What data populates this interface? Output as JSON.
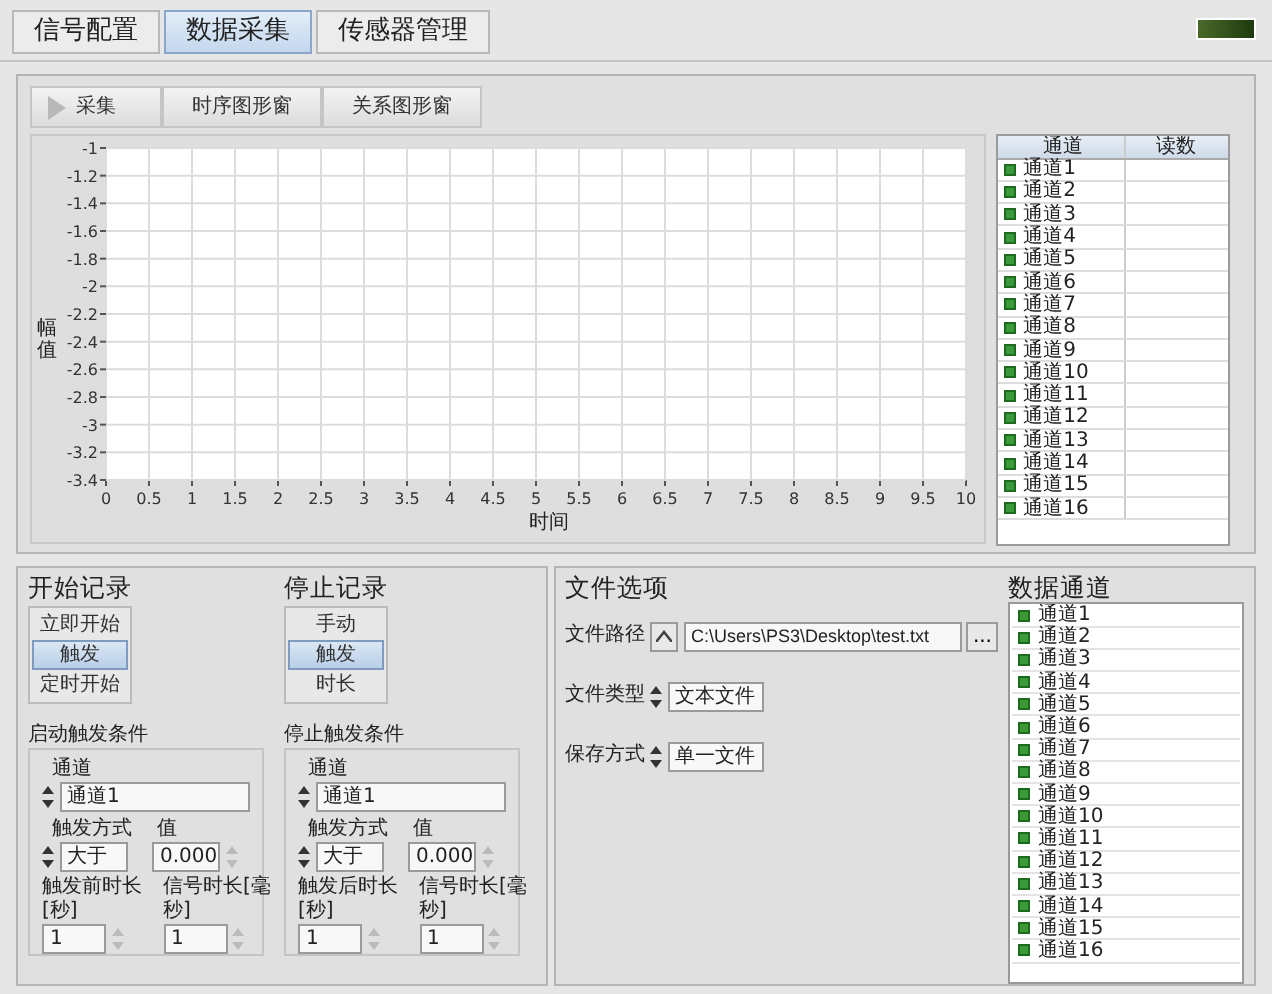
{
  "tabs": [
    {
      "label": "信号配置",
      "selected": false
    },
    {
      "label": "数据采集",
      "selected": true
    },
    {
      "label": "传感器管理",
      "selected": false
    }
  ],
  "status_led": {
    "on": false
  },
  "toolbar": [
    {
      "label": "采集",
      "kind": "run"
    },
    {
      "label": "时序图形窗",
      "kind": "plain"
    },
    {
      "label": "关系图形窗",
      "kind": "plain"
    }
  ],
  "graph": {
    "chart_data": {
      "type": "line",
      "grid": true,
      "xlabel": "时间",
      "ylabel": "幅值",
      "xlim": [
        0,
        10
      ],
      "ylim": [
        -3.4,
        -1
      ],
      "xticks": [
        0,
        0.5,
        1,
        1.5,
        2,
        2.5,
        3,
        3.5,
        4,
        4.5,
        5,
        5.5,
        6,
        6.5,
        7,
        7.5,
        8,
        8.5,
        9,
        9.5,
        10
      ],
      "yticks": [
        -1,
        -1.2,
        -1.4,
        -1.6,
        -1.8,
        -2,
        -2.2,
        -2.4,
        -2.6,
        -2.8,
        -3,
        -3.2,
        -3.4
      ]
    }
  },
  "reading_table": {
    "columns": [
      "通道",
      "读数"
    ],
    "rows": [
      {
        "channel": "通道1"
      },
      {
        "channel": "通道2"
      },
      {
        "channel": "通道3"
      },
      {
        "channel": "通道4"
      },
      {
        "channel": "通道5"
      },
      {
        "channel": "通道6"
      },
      {
        "channel": "通道7"
      },
      {
        "channel": "通道8"
      },
      {
        "channel": "通道9"
      },
      {
        "channel": "通道10"
      },
      {
        "channel": "通道11"
      },
      {
        "channel": "通道12"
      },
      {
        "channel": "通道13"
      },
      {
        "channel": "通道14"
      },
      {
        "channel": "通道15"
      },
      {
        "channel": "通道16"
      }
    ]
  },
  "start_record": {
    "title": "开始记录",
    "options": [
      {
        "label": "立即开始",
        "selected": false
      },
      {
        "label": "触发",
        "selected": true
      },
      {
        "label": "定时开始",
        "selected": false
      }
    ]
  },
  "stop_record": {
    "title": "停止记录",
    "options": [
      {
        "label": "手动",
        "selected": false
      },
      {
        "label": "触发",
        "selected": true
      },
      {
        "label": "时长",
        "selected": false
      }
    ]
  },
  "start_trigger": {
    "title": "启动触发条件",
    "channel_label": "通道",
    "channel": "通道1",
    "mode_label": "触发方式",
    "mode": "大于",
    "value_label": "值",
    "value": "0.000",
    "duration_label": "触发前时长[秒]",
    "duration": "1",
    "signal_label": "信号时长[毫秒]",
    "signal": "1"
  },
  "stop_trigger": {
    "title": "停止触发条件",
    "channel_label": "通道",
    "channel": "通道1",
    "mode_label": "触发方式",
    "mode": "大于",
    "value_label": "值",
    "value": "0.000",
    "duration_label": "触发后时长[秒]",
    "duration": "1",
    "signal_label": "信号时长[毫秒]",
    "signal": "1"
  },
  "file_options": {
    "title": "文件选项",
    "path_label": "文件路径",
    "path": "C:\\Users\\PS3\\Desktop\\test.txt",
    "browse_button": "...",
    "type_label": "文件类型",
    "type": "文本文件",
    "save_label": "保存方式",
    "save": "单一文件"
  },
  "data_channels": {
    "title": "数据通道",
    "items": [
      "通道1",
      "通道2",
      "通道3",
      "通道4",
      "通道5",
      "通道6",
      "通道7",
      "通道8",
      "通道9",
      "通道10",
      "通道11",
      "通道12",
      "通道13",
      "通道14",
      "通道15",
      "通道16"
    ]
  }
}
